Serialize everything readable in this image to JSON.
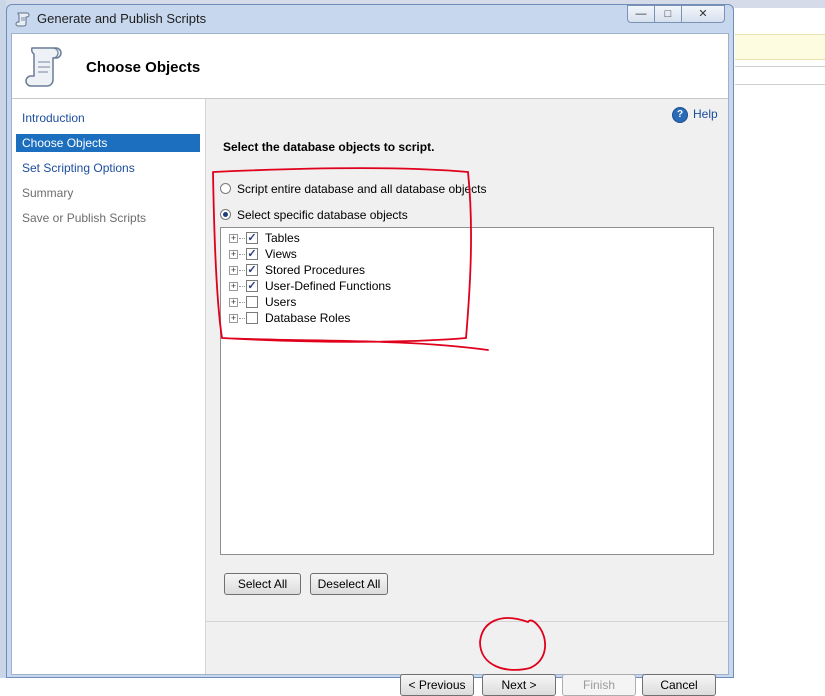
{
  "window": {
    "title": "Generate and Publish Scripts",
    "minimize_glyph": "—",
    "maximize_glyph": "□",
    "close_glyph": "✕"
  },
  "header": {
    "title": "Choose Objects"
  },
  "nav": {
    "items": [
      {
        "label": "Introduction",
        "state": "link"
      },
      {
        "label": "Choose Objects",
        "state": "selected"
      },
      {
        "label": "Set Scripting Options",
        "state": "link"
      },
      {
        "label": "Summary",
        "state": "disabled"
      },
      {
        "label": "Save or Publish Scripts",
        "state": "disabled"
      }
    ]
  },
  "main": {
    "help_label": "Help",
    "instruction": "Select the database objects to script.",
    "radio_entire": "Script entire database and all database objects",
    "radio_specific": "Select specific database objects",
    "tree": [
      {
        "label": "Tables",
        "checked": true
      },
      {
        "label": "Views",
        "checked": true
      },
      {
        "label": "Stored Procedures",
        "checked": true
      },
      {
        "label": "User-Defined Functions",
        "checked": true
      },
      {
        "label": "Users",
        "checked": false
      },
      {
        "label": "Database Roles",
        "checked": false
      }
    ],
    "select_all": "Select All",
    "deselect_all": "Deselect All"
  },
  "footer": {
    "previous": "< Previous",
    "next": "Next >",
    "finish": "Finish",
    "cancel": "Cancel"
  },
  "colors": {
    "selected_nav": "#1c6fbf",
    "link": "#1c4d9c",
    "annotation": "#e0001b"
  },
  "expander_glyph": "+",
  "check_glyph": "✓"
}
